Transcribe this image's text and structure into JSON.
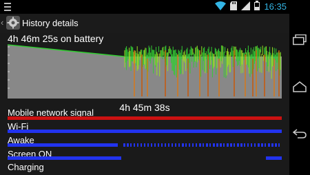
{
  "status_bar": {
    "time": "16:35",
    "icons": [
      "notification-list-icon",
      "wifi-icon",
      "sd-card-icon",
      "signal-icon",
      "battery-icon"
    ]
  },
  "action_bar": {
    "title": "History details",
    "up_icon": "chevron-left-icon",
    "app_icon": "settings-gear-icon"
  },
  "battery": {
    "on_battery_label": "4h 46m 25s on battery",
    "duration_label": "4h 45m 38s"
  },
  "rows": {
    "mobile_network_signal": "Mobile network signal",
    "wifi": "Wi-Fi",
    "awake": "Awake",
    "screen_on": "Screen ON",
    "charging": "Charging"
  },
  "colors": {
    "battery_fill": "#888888",
    "battery_line": "#33cc33",
    "signal_bar": "#cc1111",
    "state_bar": "#2233ee",
    "drop_line": "#ff6600"
  },
  "navigation": {
    "buttons": [
      "recent-apps-icon",
      "home-icon",
      "back-icon"
    ]
  }
}
